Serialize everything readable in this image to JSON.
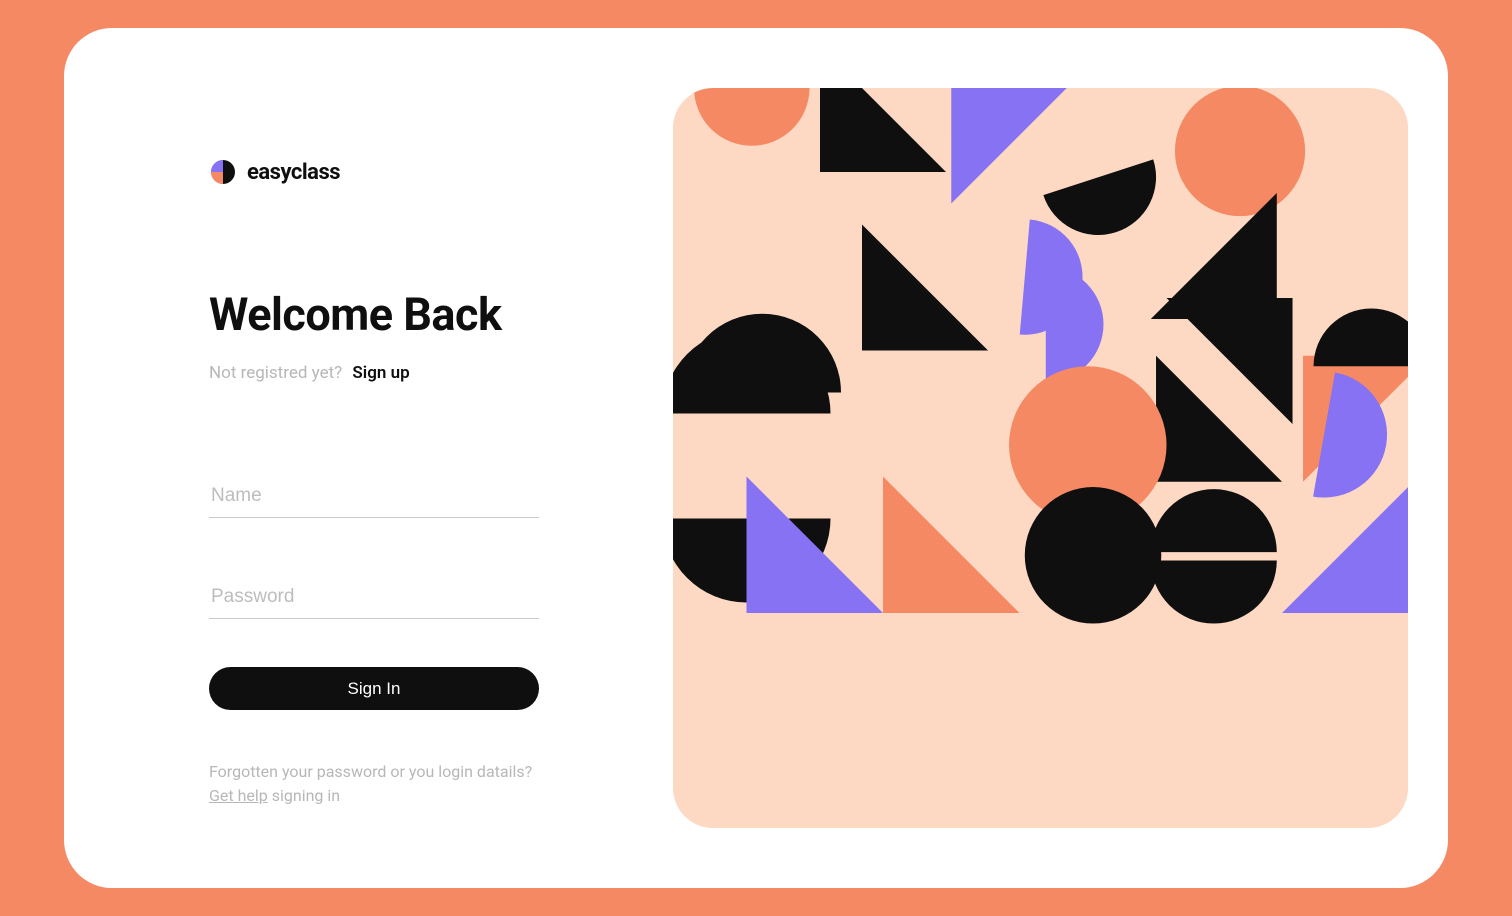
{
  "brand": {
    "name": "easyclass"
  },
  "heading": "Welcome Back",
  "signup": {
    "prompt": "Not registred yet?",
    "link": "Sign up"
  },
  "fields": {
    "name_placeholder": "Name",
    "password_placeholder": "Password"
  },
  "buttons": {
    "signin": "Sign In"
  },
  "help": {
    "pre": "Forgotten your password or you login datails? ",
    "link": "Get help",
    "post": " signing in"
  },
  "colors": {
    "bg": "#f58964",
    "card": "#ffffff",
    "art_bg": "#fdd8c3",
    "orange": "#f58964",
    "purple": "#8672f3",
    "black": "#0f0f0f"
  }
}
